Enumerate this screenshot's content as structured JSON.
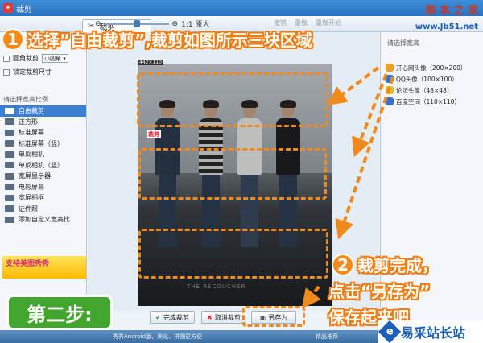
{
  "window": {
    "title": "裁剪"
  },
  "watermark": {
    "top": "脚 本 之 家",
    "url": "www.Jb51.net"
  },
  "toolbar": {
    "tab_label": "裁剪",
    "zoom_label": "1:1 原大",
    "actions": [
      "撤销",
      "重做",
      "重做开始"
    ]
  },
  "left_panel": {
    "circle_crop": {
      "label": "圆角裁剪",
      "select_value": "小圆角"
    },
    "lock_size": {
      "label": "锁定裁剪尺寸"
    },
    "ratio_title": "请选择宽高比例",
    "ratios": [
      {
        "icon": "free",
        "label": "自由裁剪",
        "active": true
      },
      {
        "icon": "1:1",
        "label": "正方形",
        "active": false
      },
      {
        "icon": "4:3",
        "label": "标准屏幕",
        "active": false
      },
      {
        "icon": "3:4",
        "label": "标准屏幕（竖）",
        "active": false
      },
      {
        "icon": "3:2",
        "label": "单反相机",
        "active": false
      },
      {
        "icon": "2:3",
        "label": "单反相机（竖）",
        "active": false
      },
      {
        "icon": "16:10",
        "label": "宽屏显示器",
        "active": false
      },
      {
        "icon": "16:9",
        "label": "电影屏幕",
        "active": false
      },
      {
        "icon": "5:4",
        "label": "宽屏相框",
        "active": false
      },
      {
        "icon": "id",
        "label": "证件照",
        "active": false
      },
      {
        "icon": "plus",
        "label": "添加自定义宽高比",
        "active": false
      }
    ],
    "promo": "支持美图秀秀"
  },
  "canvas": {
    "dimension_label": "442×110",
    "crop_tag": "裁剪",
    "photo_caption": "THE RECOUCHER"
  },
  "bottom": {
    "done_label": "完成裁剪",
    "cancel_label": "取消裁剪",
    "save_as_label": "另存为"
  },
  "right_panel": {
    "title": "请选择宽高",
    "items": [
      {
        "label": "开心网头像（200×200）",
        "color": "#f0a020"
      },
      {
        "label": "QQ头像（100×100）",
        "color": "#2b7bd6"
      },
      {
        "label": "论坛头像（48×48）",
        "color": "#e0c020"
      },
      {
        "label": "百度空间（110×110）",
        "color": "#3a6fd6"
      }
    ]
  },
  "statusbar": {
    "tip": "秀秀Android版，美化、拼图更方便",
    "stat": "精品推荐"
  },
  "annotations": {
    "step1_number": "1",
    "step1_text": "选择”自由裁剪”,裁剪如图所示三块区域",
    "step2_number": "2",
    "step2_line1": "裁剪完成，",
    "step2_line2": "点击“另存为”",
    "step2_line3": "保存起来吧",
    "step_badge": "第二步:",
    "site_name": "易采站长站"
  },
  "colors": {
    "accent": "#f58a1a",
    "badge": "#42a52e",
    "titlebar": "#2a72c1"
  }
}
